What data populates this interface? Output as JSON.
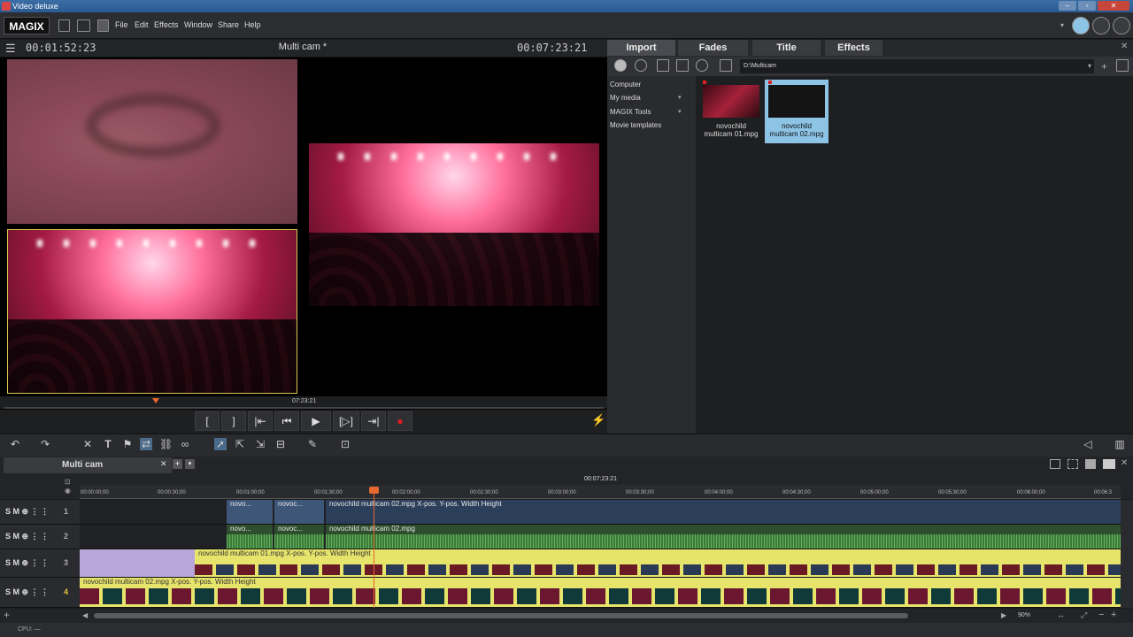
{
  "window": {
    "title": "Video deluxe",
    "controls": [
      "–",
      "▫",
      "✕"
    ]
  },
  "menubar": {
    "logo": "MAGIX",
    "items": [
      "File",
      "Edit",
      "Effects",
      "Window",
      "Share",
      "Help"
    ]
  },
  "monitor": {
    "timecode_left": "00:01:52:23",
    "title": "Multi cam *",
    "timecode_right": "00:07:23:21",
    "scrub_timecode": "07:23:21",
    "transport": [
      "[",
      "]",
      "|⇤",
      "⏮",
      "▶",
      "[▷]",
      "⇥|",
      "●"
    ]
  },
  "media_pool": {
    "tabs": [
      "Import",
      "Fades",
      "Title",
      "Effects"
    ],
    "active_tab": "Import",
    "path": "D:\\Multicam",
    "tree": [
      {
        "label": "Computer",
        "arrow": ""
      },
      {
        "label": "My media",
        "arrow": "▾"
      },
      {
        "label": "MAGIX Tools",
        "arrow": "▾"
      },
      {
        "label": "Movie templates",
        "arrow": ""
      }
    ],
    "files": [
      {
        "name_line1": "novochild",
        "name_line2": "multicam 01.mpg",
        "selected": false
      },
      {
        "name_line1": "novochild",
        "name_line2": "multicam 02.mpg",
        "selected": true
      }
    ]
  },
  "timeline": {
    "project_tab": "Multi cam",
    "ruler_timecode": "00:07:23:21",
    "ruler_labels": [
      "00:00:00;00",
      "00:00:30;00",
      "00:01:00;00",
      "00:01:30;00",
      "00:02:00;00",
      "00:02:30;00",
      "00:03:00;00",
      "00:03:30;00",
      "00:04:00;00",
      "00:04:30;00",
      "00:05:00;00",
      "00:05:30;00",
      "00:06:00;00",
      "00:06:3"
    ],
    "tracks": [
      {
        "number": "1",
        "controls": "S M ⊕ ⋮ ⋮"
      },
      {
        "number": "2",
        "controls": "S M ⊕ ⋮ ⋮"
      },
      {
        "number": "3",
        "controls": "S M ⊕ ⋮ ⋮"
      },
      {
        "number": "4",
        "controls": "S M ⊕ ⋮ ⋮"
      }
    ],
    "clips": {
      "t1_a": "novo...",
      "t1_b": "novoc...",
      "t1_c": "novochild multicam 02.mpg   X-pos.  Y-pos.  Width  Height",
      "t2_a": "novo...",
      "t2_b": "novoc...",
      "t2_c": "novochild multicam 02.mpg",
      "t3": "novochild multicam 01.mpg   X-pos.  Y-pos.  Width  Height",
      "t4": "novochild multicam 02.mpg   X-pos.  Y-pos.  Width  Height"
    },
    "zoom": "90%"
  },
  "status": {
    "cpu": "CPU: —"
  },
  "colors": {
    "accent": "#e6692f",
    "selection": "#8dc4e6",
    "clip_yellow": "#e7e46b"
  }
}
